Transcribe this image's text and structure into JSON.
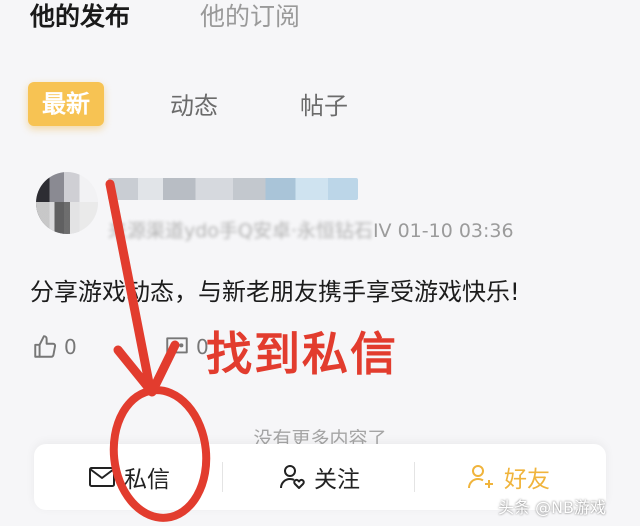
{
  "top_tabs": {
    "my_posts": "他的发布",
    "my_subscriptions": "他的订阅"
  },
  "sub_tabs": {
    "latest": "最新",
    "activity": "动态",
    "posts": "帖子"
  },
  "post": {
    "meta_blurred": "来源渠道ydo手Q安卓·永恒钻石",
    "meta_visible": "IV 01-10 03:36",
    "content": "分享游戏动态，与新老朋友携手享受游戏快乐!",
    "like_count": "0",
    "comment_count": "0"
  },
  "annotation": {
    "text": "找到私信",
    "color": "#e23c2e"
  },
  "no_more": "没有更多内容了",
  "bottom_bar": {
    "message": "私信",
    "follow": "关注",
    "friend": "好友"
  },
  "watermark": "头条 @NB游戏",
  "colors": {
    "accent": "#f7c353",
    "friend": "#f0b43c",
    "annotation_red": "#e23c2e"
  }
}
